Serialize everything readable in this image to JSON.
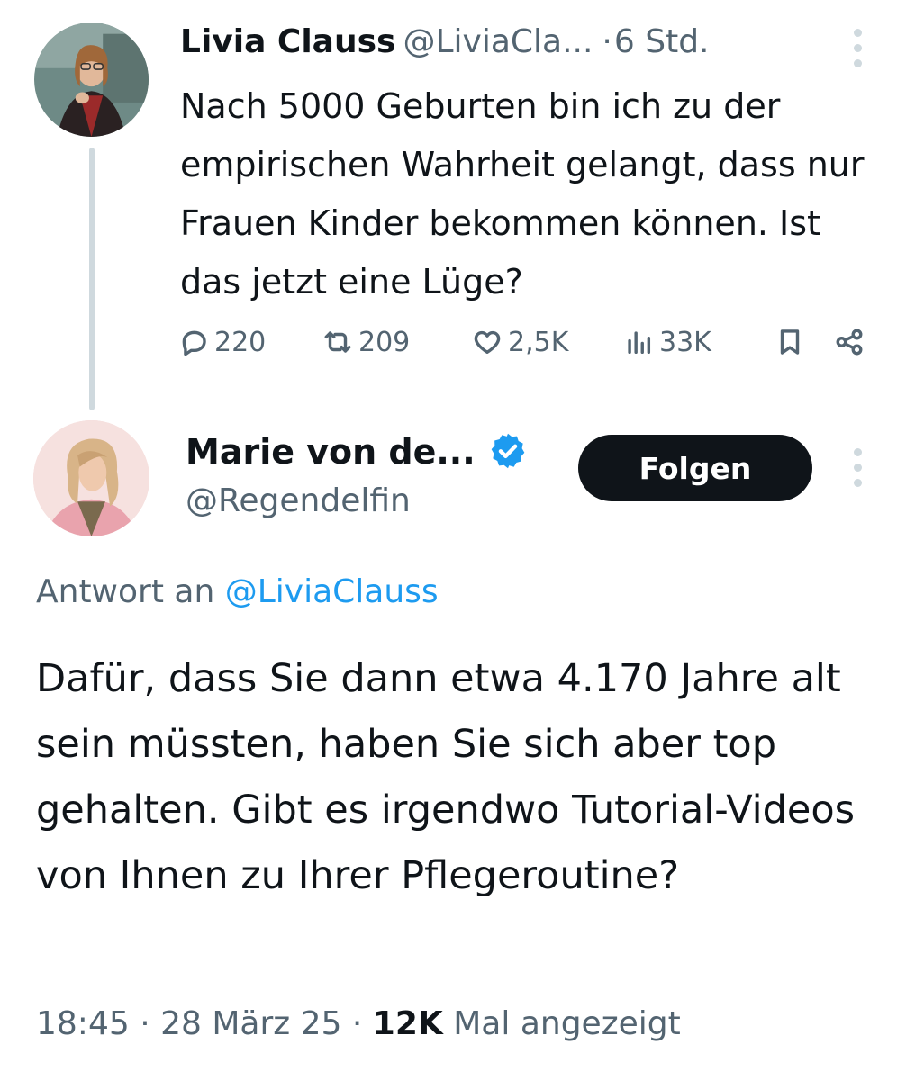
{
  "tweet1": {
    "author_name": "Livia Clauss",
    "handle": "@LiviaCla...",
    "separator": "·",
    "time": "6 Std.",
    "text": "Nach 5000 Geburten bin ich zu der empirischen Wahrheit gelangt, dass nur Frauen Kinder bekommen können. Ist das jetzt eine Lüge?",
    "stats": {
      "replies": "220",
      "reposts": "209",
      "likes": "2,5K",
      "views": "33K"
    }
  },
  "tweet2": {
    "author_name": "Marie von de...",
    "handle": "@Regendelfin",
    "verified": true,
    "follow_label": "Folgen",
    "reply_prefix": "Antwort an",
    "reply_handle": "@LiviaClauss",
    "text": "Dafür, dass Sie dann etwa 4.170 Jahre alt sein müssten, haben Sie sich aber top gehalten. Gibt es irgendwo Tutorial-Videos von Ihnen zu Ihrer Pflegeroutine?",
    "time": "18:45",
    "date": "28 März 25",
    "separator": "·",
    "views": "12K",
    "views_suffix": "Mal angezeigt"
  },
  "icons": {
    "reply": "speech-bubble-icon",
    "repost": "repost-arrows-icon",
    "like": "heart-icon",
    "views": "bar-chart-icon",
    "bookmark": "bookmark-icon",
    "share": "share-nodes-icon",
    "verified": "verified-badge-icon",
    "more": "vertical-ellipsis-icon"
  },
  "colors": {
    "text": "#0f1419",
    "secondary": "#536471",
    "accent": "#1d9bf0",
    "follow_button": "#0f1419",
    "thread_line": "#cfd9de"
  }
}
